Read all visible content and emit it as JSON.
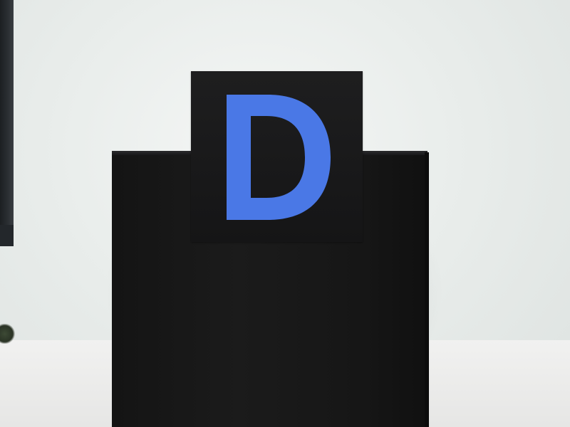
{
  "scene": {
    "card": {
      "letter": "D",
      "letter_color": "#4a78e6",
      "card_color": "#161617"
    },
    "box_color": "#161616",
    "wall_color": "#e9edeb"
  }
}
